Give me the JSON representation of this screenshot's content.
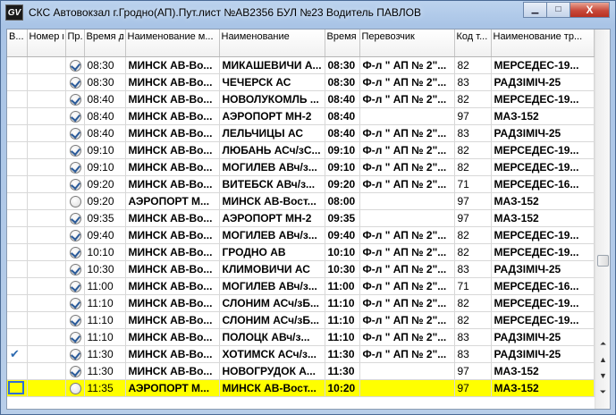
{
  "window": {
    "app_icon": "GV",
    "title": "СКС Автовокзал г.Гродно(АП).Пут.лист №АВ2356 БУЛ №23 Водитель ПАВЛОВ",
    "minimize": "▁",
    "maximize": "□",
    "close": "X"
  },
  "columns": [
    "В...",
    "Номер марш...",
    "Пр.",
    "Время диспе...",
    "Наименование м...",
    "Наименование",
    "Время отпр...",
    "Перевозчик",
    "Код т...",
    "Наименование тр..."
  ],
  "rows": [
    {
      "v": "",
      "num": "",
      "check": "on",
      "disp": "08:30",
      "route": "МИНСК АВ-Во...",
      "name": "МИКАШЕВИЧИ А...",
      "dep": "08:30",
      "carrier": "Ф-л \" АП № 2\"...",
      "code": "82",
      "vehicle": "МЕРСЕДЕС-19..."
    },
    {
      "v": "",
      "num": "",
      "check": "on",
      "disp": "08:30",
      "route": "МИНСК АВ-Во...",
      "name": "ЧЕЧЕРСК АС",
      "dep": "08:30",
      "carrier": "Ф-л \" АП № 2\"...",
      "code": "83",
      "vehicle": "РАДЗІМІЧ-25"
    },
    {
      "v": "",
      "num": "",
      "check": "on",
      "disp": "08:40",
      "route": "МИНСК АВ-Во...",
      "name": "НОВОЛУКОМЛЬ ...",
      "dep": "08:40",
      "carrier": "Ф-л \" АП № 2\"...",
      "code": "82",
      "vehicle": "МЕРСЕДЕС-19..."
    },
    {
      "v": "",
      "num": "",
      "check": "on",
      "disp": "08:40",
      "route": "МИНСК АВ-Во...",
      "name": "АЭРОПОРТ МН-2",
      "dep": "08:40",
      "carrier": "",
      "code": "97",
      "vehicle": "МАЗ-152"
    },
    {
      "v": "",
      "num": "",
      "check": "on",
      "disp": "08:40",
      "route": "МИНСК АВ-Во...",
      "name": "ЛЕЛЬЧИЦЫ АС",
      "dep": "08:40",
      "carrier": "Ф-л \" АП № 2\"...",
      "code": "83",
      "vehicle": "РАДЗІМІЧ-25"
    },
    {
      "v": "",
      "num": "",
      "check": "on",
      "disp": "09:10",
      "route": "МИНСК АВ-Во...",
      "name": "ЛЮБАНЬ АСч/зС...",
      "dep": "09:10",
      "carrier": "Ф-л \" АП № 2\"...",
      "code": "82",
      "vehicle": "МЕРСЕДЕС-19..."
    },
    {
      "v": "",
      "num": "",
      "check": "on",
      "disp": "09:10",
      "route": "МИНСК АВ-Во...",
      "name": "МОГИЛЕВ АВч/з...",
      "dep": "09:10",
      "carrier": "Ф-л \" АП № 2\"...",
      "code": "82",
      "vehicle": "МЕРСЕДЕС-19..."
    },
    {
      "v": "",
      "num": "",
      "check": "on",
      "disp": "09:20",
      "route": "МИНСК АВ-Во...",
      "name": "ВИТЕБСК АВч/з...",
      "dep": "09:20",
      "carrier": "Ф-л \" АП № 2\"...",
      "code": "71",
      "vehicle": "МЕРСЕДЕС-16..."
    },
    {
      "v": "",
      "num": "",
      "check": "off",
      "disp": "09:20",
      "route": "АЭРОПОРТ М...",
      "name": "МИНСК АВ-Вост...",
      "dep": "08:00",
      "carrier": "",
      "code": "97",
      "vehicle": "МАЗ-152"
    },
    {
      "v": "",
      "num": "",
      "check": "on",
      "disp": "09:35",
      "route": "МИНСК АВ-Во...",
      "name": "АЭРОПОРТ МН-2",
      "dep": "09:35",
      "carrier": "",
      "code": "97",
      "vehicle": "МАЗ-152"
    },
    {
      "v": "",
      "num": "",
      "check": "on",
      "disp": "09:40",
      "route": "МИНСК АВ-Во...",
      "name": "МОГИЛЕВ АВч/з...",
      "dep": "09:40",
      "carrier": "Ф-л \" АП № 2\"...",
      "code": "82",
      "vehicle": "МЕРСЕДЕС-19..."
    },
    {
      "v": "",
      "num": "",
      "check": "on",
      "disp": "10:10",
      "route": "МИНСК АВ-Во...",
      "name": "ГРОДНО АВ",
      "dep": "10:10",
      "carrier": "Ф-л \" АП № 2\"...",
      "code": "82",
      "vehicle": "МЕРСЕДЕС-19..."
    },
    {
      "v": "",
      "num": "",
      "check": "on",
      "disp": "10:30",
      "route": "МИНСК АВ-Во...",
      "name": "КЛИМОВИЧИ АС",
      "dep": "10:30",
      "carrier": "Ф-л \" АП № 2\"...",
      "code": "83",
      "vehicle": "РАДЗІМІЧ-25"
    },
    {
      "v": "",
      "num": "",
      "check": "on",
      "disp": "11:00",
      "route": "МИНСК АВ-Во...",
      "name": "МОГИЛЕВ АВч/з...",
      "dep": "11:00",
      "carrier": "Ф-л \" АП № 2\"...",
      "code": "71",
      "vehicle": "МЕРСЕДЕС-16..."
    },
    {
      "v": "",
      "num": "",
      "check": "on",
      "disp": "11:10",
      "route": "МИНСК АВ-Во...",
      "name": "СЛОНИМ АСч/зБ...",
      "dep": "11:10",
      "carrier": "Ф-л \" АП № 2\"...",
      "code": "82",
      "vehicle": "МЕРСЕДЕС-19..."
    },
    {
      "v": "",
      "num": "",
      "check": "on",
      "disp": "11:10",
      "route": "МИНСК АВ-Во...",
      "name": "СЛОНИМ АСч/зБ...",
      "dep": "11:10",
      "carrier": "Ф-л \" АП № 2\"...",
      "code": "82",
      "vehicle": "МЕРСЕДЕС-19..."
    },
    {
      "v": "",
      "num": "",
      "check": "on",
      "disp": "11:10",
      "route": "МИНСК АВ-Во...",
      "name": "ПОЛОЦК АВч/з...",
      "dep": "11:10",
      "carrier": "Ф-л \" АП № 2\"...",
      "code": "83",
      "vehicle": "РАДЗІМІЧ-25"
    },
    {
      "v": "✔",
      "num": "",
      "check": "on",
      "disp": "11:30",
      "route": "МИНСК АВ-Во...",
      "name": "ХОТИМСК АСч/з...",
      "dep": "11:30",
      "carrier": "Ф-л \" АП № 2\"...",
      "code": "83",
      "vehicle": "РАДЗІМІЧ-25"
    },
    {
      "v": "",
      "num": "",
      "check": "on",
      "disp": "11:30",
      "route": "МИНСК АВ-Во...",
      "name": "НОВОГРУДОК А...",
      "dep": "11:30",
      "carrier": "",
      "code": "97",
      "vehicle": "МАЗ-152"
    },
    {
      "v": "sel",
      "num": "",
      "check": "off",
      "disp": "11:35",
      "route": "АЭРОПОРТ М...",
      "name": "МИНСК АВ-Вост...",
      "dep": "10:20",
      "carrier": "",
      "code": "97",
      "vehicle": "МАЗ-152",
      "selected": true
    }
  ],
  "scrollbar": {
    "top_arrow": "⌃",
    "btns": [
      "⌃",
      "⌄",
      "⌃",
      "⌄"
    ]
  }
}
